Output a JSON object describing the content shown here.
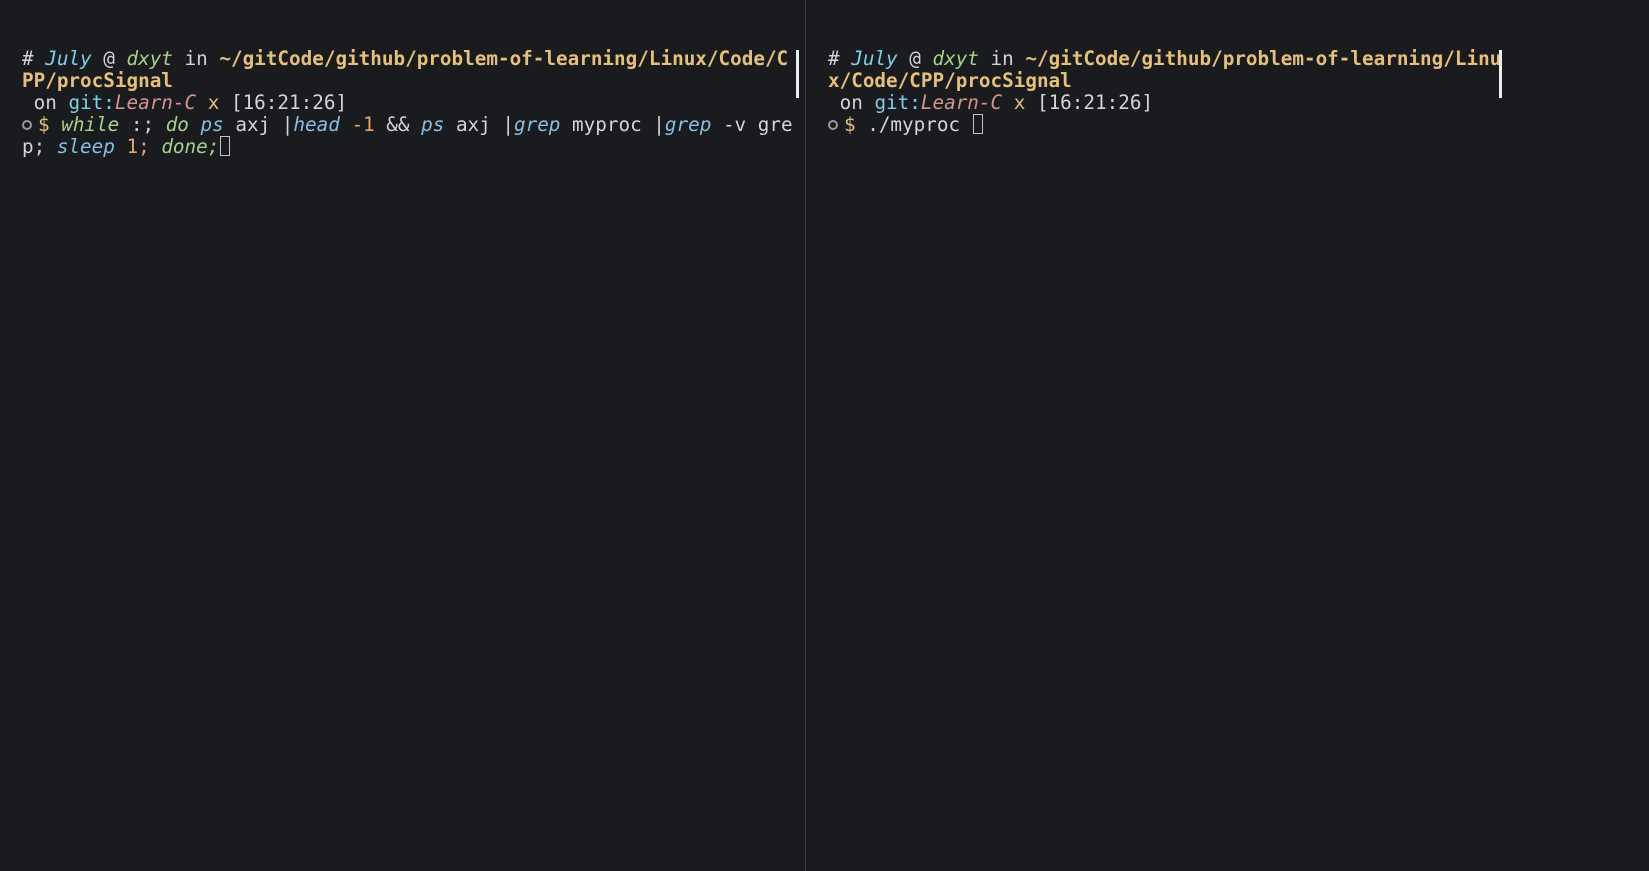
{
  "left": {
    "prompt": {
      "hash": "#",
      "user": "July",
      "at": "@",
      "host": "dxyt",
      "in": "in",
      "path": "~/gitCode/github/problem-of-learning/Linux/Code/CPP/procSignal",
      "on": "on",
      "git": "git:",
      "branch": "Learn-C",
      "x": "x",
      "time": "[16:21:26]"
    },
    "dollar": "$",
    "command": {
      "while": "while",
      "colon": ":;",
      "do1": "do",
      "ps1": "ps",
      "axj1": "axj",
      "pipe1": "|",
      "head": "head",
      "neg1": "-1",
      "amp": "&&",
      "ps2": "ps",
      "axj2": "axj",
      "pipe2": "|",
      "grep1": "grep",
      "myproc": "myproc",
      "pipe3": "|",
      "grep2": "grep",
      "dashv": "-v",
      "greparg": "grep;",
      "sleep": "sleep",
      "one": "1;",
      "done": "done;"
    }
  },
  "right": {
    "prompt": {
      "hash": "#",
      "user": "July",
      "at": "@",
      "host": "dxyt",
      "in": "in",
      "path": "~/gitCode/github/problem-of-learning/Linux/Code/CPP/procSignal",
      "on": "on",
      "git": "git:",
      "branch": "Learn-C",
      "x": "x",
      "time": "[16:21:26]"
    },
    "dollar": "$",
    "command": {
      "exec": "./myproc"
    }
  }
}
